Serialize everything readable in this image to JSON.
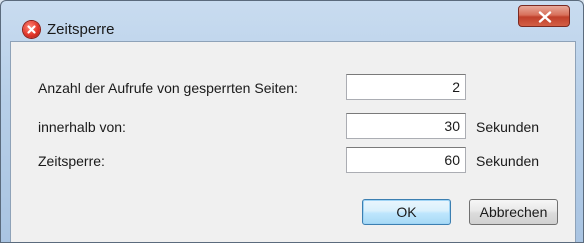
{
  "window": {
    "title": "Zeitsperre",
    "title_icon": "error-x-icon",
    "close_icon": "close-icon"
  },
  "form": {
    "rows": [
      {
        "label": "Anzahl der Aufrufe von gesperrten Seiten:",
        "value": "2",
        "unit": ""
      },
      {
        "label": "innerhalb von:",
        "value": "30",
        "unit": "Sekunden"
      },
      {
        "label": "Zeitsperre:",
        "value": "60",
        "unit": "Sekunden"
      }
    ]
  },
  "buttons": {
    "ok": "OK",
    "cancel": "Abbrechen"
  },
  "colors": {
    "title_icon": "#e2362a",
    "close_button": "#c0402b",
    "default_button_border": "#3c7fb1"
  }
}
